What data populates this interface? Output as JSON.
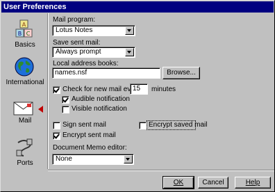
{
  "window": {
    "title": "User Preferences"
  },
  "sidebar": {
    "items": [
      {
        "label": "Basics",
        "icon": "abc-blocks-icon"
      },
      {
        "label": "International",
        "icon": "globe-icon"
      },
      {
        "label": "Mail",
        "icon": "envelope-icon",
        "selected": true
      },
      {
        "label": "Ports",
        "icon": "plug-icon"
      }
    ]
  },
  "mail": {
    "mail_program_label": "Mail program:",
    "mail_program_value": "Lotus Notes",
    "save_sent_label": "Save sent mail:",
    "save_sent_value": "Always prompt",
    "address_books_label": "Local address books:",
    "address_books_value": "names.nsf",
    "browse_label": "Browse...",
    "check_new_mail_label": "Check for new mail every",
    "check_new_mail_checked": true,
    "check_interval_value": "15",
    "minutes_label": "minutes",
    "audible_label": "Audible notification",
    "audible_checked": true,
    "visible_label": "Visible notification",
    "visible_checked": false,
    "sign_sent_label": "Sign sent mail",
    "sign_sent_checked": false,
    "encrypt_saved_label": "Encrypt saved mail",
    "encrypt_saved_checked": false,
    "encrypt_sent_label": "Encrypt sent mail",
    "encrypt_sent_checked": true,
    "memo_editor_label": "Document Memo editor:",
    "memo_editor_value": "None"
  },
  "footer": {
    "ok_label": "OK",
    "cancel_label": "Cancel",
    "help_label": "Help"
  },
  "colors": {
    "titlebar": "#000080",
    "face": "#c0c0c0",
    "selected_pointer": "#c00000"
  }
}
